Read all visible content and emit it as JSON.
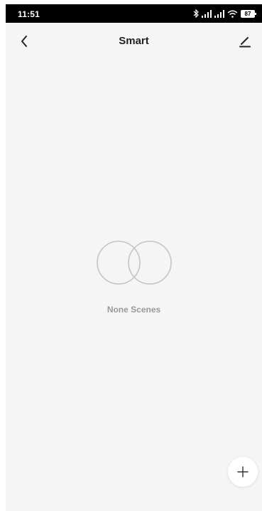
{
  "status_bar": {
    "time": "11:51",
    "battery_level": "87",
    "icons": [
      "bluetooth-icon",
      "cellular-signal-icon",
      "cellular-signal-icon",
      "wifi-icon",
      "battery-icon"
    ]
  },
  "header": {
    "title": "Smart",
    "back_icon": "chevron-left-icon",
    "edit_icon": "pencil-icon"
  },
  "empty_state": {
    "message": "None Scenes",
    "icon": "overlapping-circles-icon"
  },
  "fab": {
    "icon": "plus-icon"
  },
  "colors": {
    "background": "#f5f5f5",
    "status_bar": "#000000",
    "title": "#222222",
    "muted_text": "#999999",
    "illustration_stroke": "#c4c4c4"
  }
}
